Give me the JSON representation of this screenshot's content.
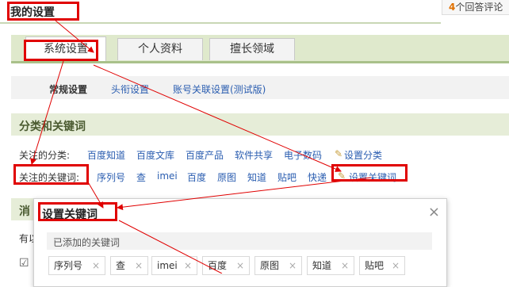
{
  "page": {
    "title": "我的设置"
  },
  "answers": {
    "count": "4",
    "label": "个回答评论"
  },
  "tabs": [
    {
      "label": "系统设置"
    },
    {
      "label": "个人资料"
    },
    {
      "label": "擅长领域"
    }
  ],
  "subnav": [
    {
      "label": "常规设置"
    },
    {
      "label": "头衔设置"
    },
    {
      "label": "账号关联设置(测试版)"
    }
  ],
  "section": {
    "title": "分类和关键词"
  },
  "categories": {
    "label": "关注的分类:",
    "items": [
      "百度知道",
      "百度文库",
      "百度产品",
      "软件共享",
      "电子数码"
    ],
    "setting_link": "设置分类"
  },
  "keywords": {
    "label": "关注的关键词:",
    "items": [
      "序列号",
      "查",
      "imei",
      "百度",
      "原图",
      "知道",
      "贴吧",
      "快递"
    ],
    "setting_link": "设置关键词"
  },
  "left_partial": {
    "section2": "消",
    "text": "有以",
    "checkbox": "☑"
  },
  "modal": {
    "title": "设置关键词",
    "close": "×",
    "added_label": "已添加的关键词",
    "keywords": [
      "序列号",
      "查",
      "imei",
      "百度",
      "原图",
      "知道",
      "贴吧"
    ],
    "remove_glyph": "×"
  },
  "colors": {
    "annotation_red": "#e00000",
    "link_blue": "#2a5db0"
  }
}
